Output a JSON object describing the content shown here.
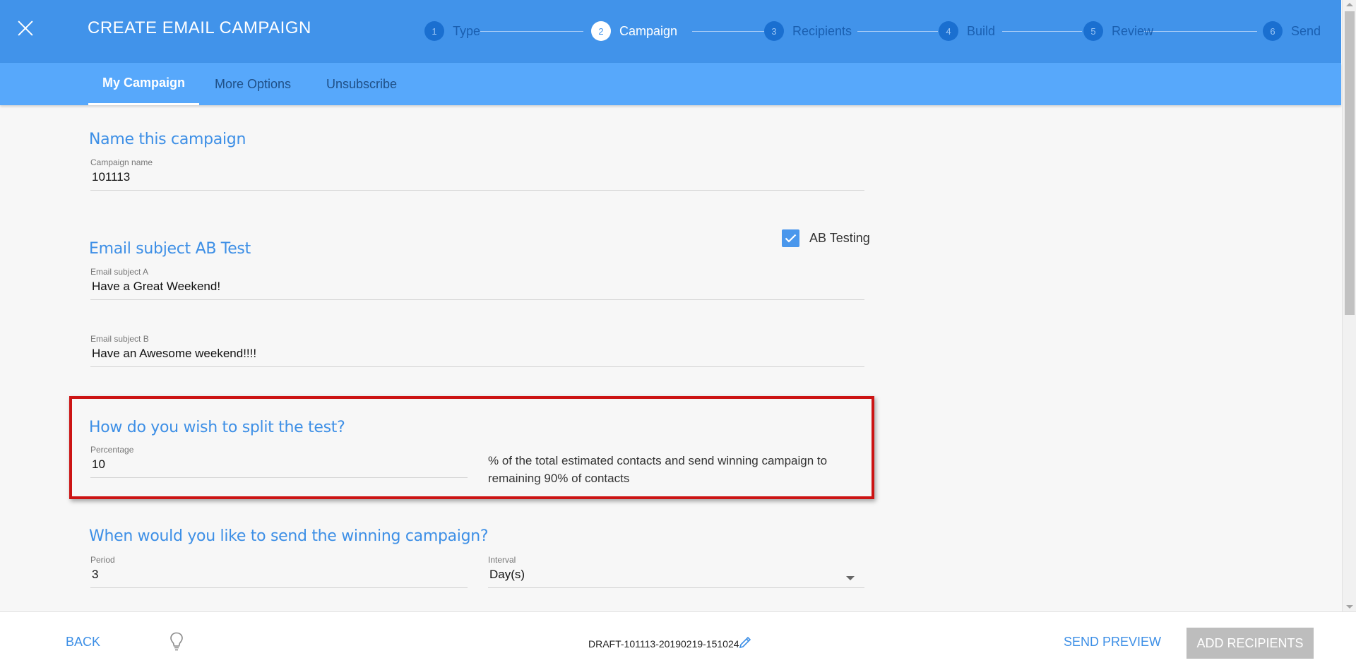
{
  "header": {
    "title": "CREATE EMAIL CAMPAIGN",
    "close_icon": "close-icon",
    "steps": [
      {
        "number": "1",
        "label": "Type",
        "active": false
      },
      {
        "number": "2",
        "label": "Campaign",
        "active": true
      },
      {
        "number": "3",
        "label": "Recipients",
        "active": false
      },
      {
        "number": "4",
        "label": "Build",
        "active": false
      },
      {
        "number": "5",
        "label": "Review",
        "active": false
      },
      {
        "number": "6",
        "label": "Send",
        "active": false
      }
    ]
  },
  "tabs": [
    {
      "label": "My Campaign",
      "active": true
    },
    {
      "label": "More Options",
      "active": false
    },
    {
      "label": "Unsubscribe",
      "active": false
    }
  ],
  "campaign": {
    "section_title": "Name this campaign",
    "name_label": "Campaign name",
    "name_value": "101113"
  },
  "subject": {
    "section_title": "Email subject AB Test",
    "ab_testing_label": "AB Testing",
    "ab_testing_checked": true,
    "subject_a_label": "Email subject A",
    "subject_a_value": "Have a Great Weekend!",
    "subject_b_label": "Email subject B",
    "subject_b_value": "Have an Awesome weekend!!!!"
  },
  "split": {
    "section_title": "How do you wish to split the test?",
    "percentage_label": "Percentage",
    "percentage_value": "10",
    "note": "% of the total estimated contacts and send winning campaign to remaining 90% of contacts"
  },
  "winning": {
    "section_title": "When would you like to send the winning campaign?",
    "period_label": "Period",
    "period_value": "3",
    "interval_label": "Interval",
    "interval_value": "Day(s)"
  },
  "footer": {
    "back_label": "BACK",
    "draft_name": "DRAFT-101113-20190219-151024",
    "send_preview_label": "SEND PREVIEW",
    "add_recipients_label": "ADD RECIPIENTS"
  },
  "colors": {
    "header_bg": "#4193ea",
    "tabbar_bg": "#57a8fb",
    "accent": "#3d8fe6",
    "highlight": "#cc1414",
    "disabled_button": "#bdbdbd"
  }
}
